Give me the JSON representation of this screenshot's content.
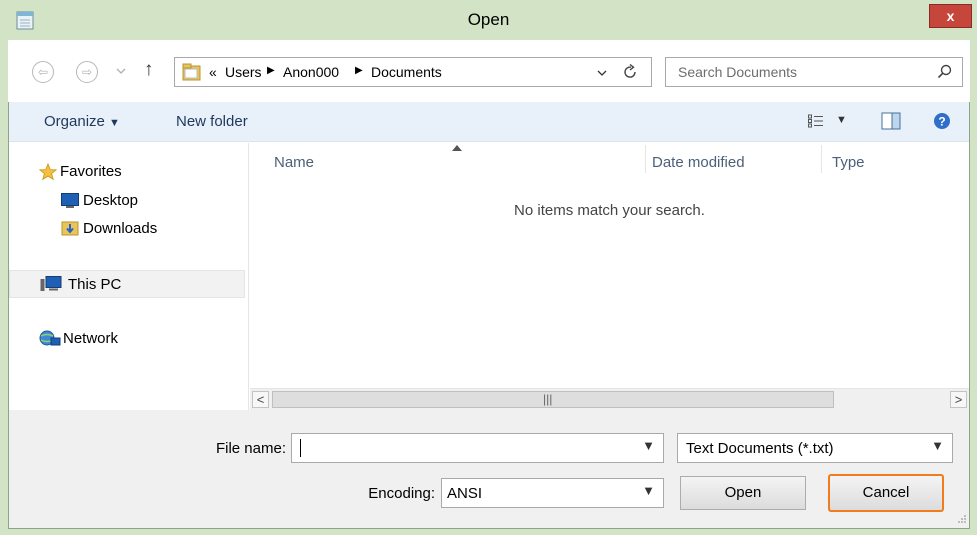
{
  "window": {
    "title": "Open",
    "close_label": "x"
  },
  "navigation": {
    "back_label": "⇦",
    "forward_label": "⇨",
    "up_label": "↑",
    "breadcrumb": {
      "overflow": "«",
      "items": [
        "Users",
        "Anon000",
        "Documents"
      ]
    },
    "search_placeholder": "Search Documents"
  },
  "toolbar": {
    "organize_label": "Organize",
    "new_folder_label": "New folder"
  },
  "sidebar": {
    "favorites": {
      "label": "Favorites",
      "items": [
        "Desktop",
        "Downloads"
      ]
    },
    "this_pc": "This PC",
    "network": "Network"
  },
  "file_list": {
    "columns": [
      "Name",
      "Date modified",
      "Type"
    ],
    "empty_message": "No items match your search."
  },
  "bottom": {
    "file_name_label": "File name:",
    "file_name_value": "",
    "file_type_value": "Text Documents (*.txt)",
    "encoding_label": "Encoding:",
    "encoding_value": "ANSI",
    "open_label": "Open",
    "cancel_label": "Cancel"
  },
  "colors": {
    "highlight": "#f07c1e",
    "toolbar_bg": "#e8f0fa",
    "window_frame": "#d3e3c5"
  }
}
